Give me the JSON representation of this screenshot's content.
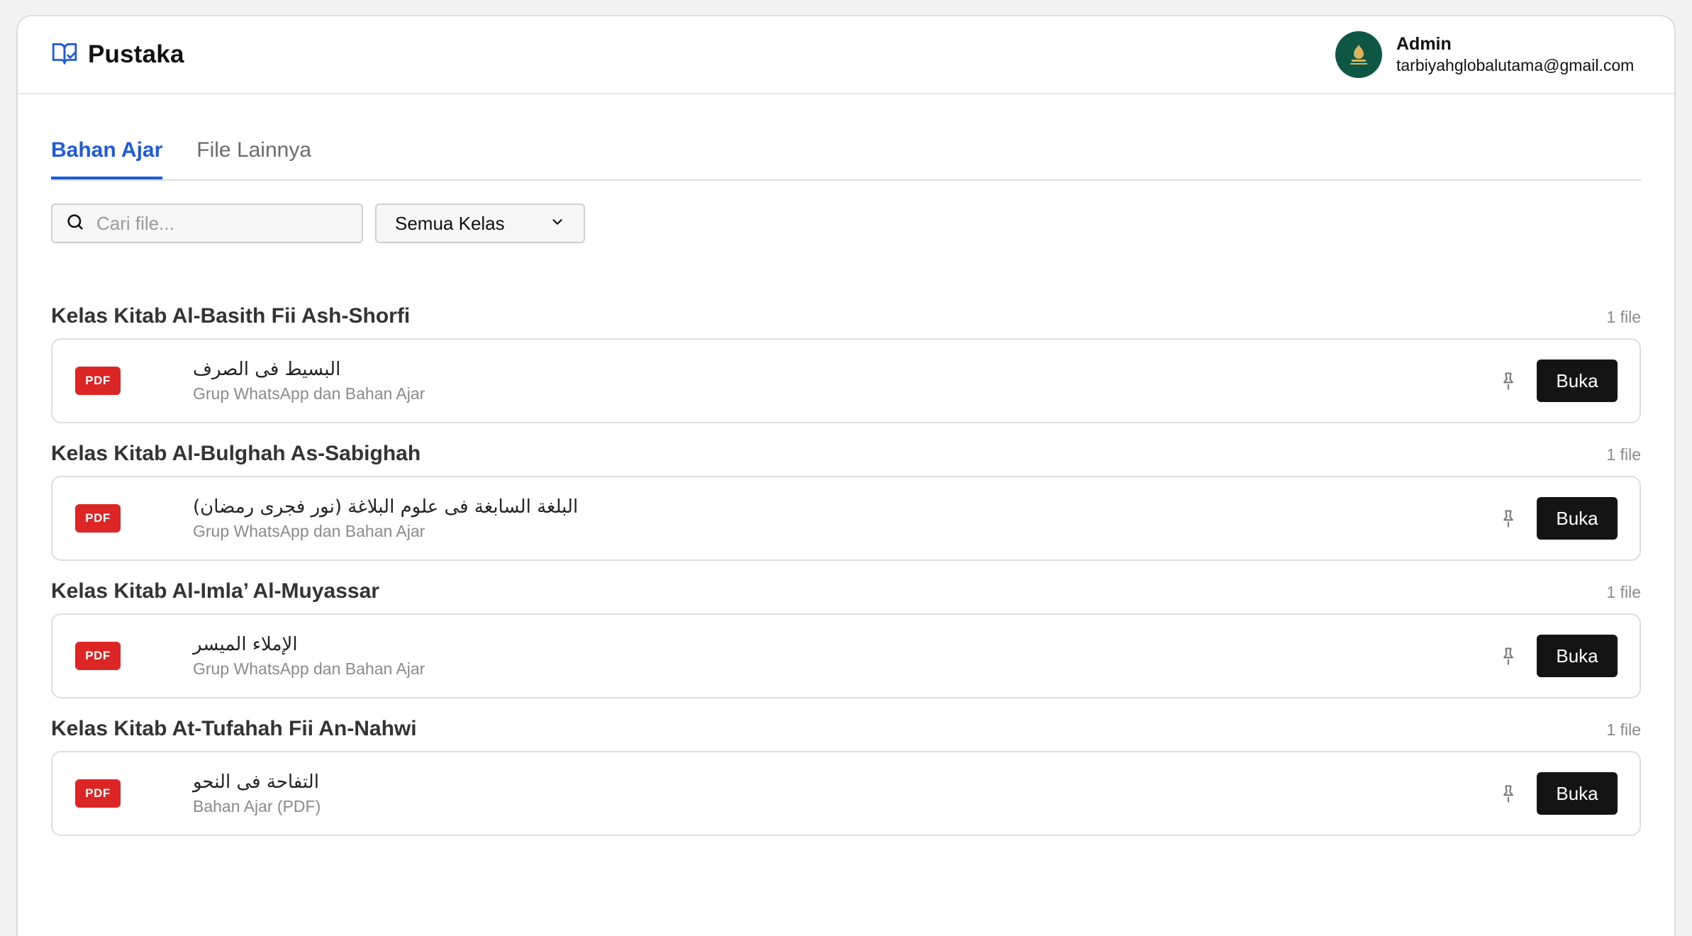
{
  "app": {
    "name": "Pustaka",
    "logo_icon": "book-open-check-icon"
  },
  "user": {
    "name": "Admin",
    "email": "tarbiyahglobalutama@gmail.com",
    "avatar_color": "#0d5744"
  },
  "tabs": [
    {
      "label": "Bahan Ajar",
      "active": true
    },
    {
      "label": "File Lainnya",
      "active": false
    }
  ],
  "search": {
    "placeholder": "Cari file...",
    "value": ""
  },
  "class_filter": {
    "selected": "Semua Kelas"
  },
  "colors": {
    "accent": "#1d5bd8",
    "pdf_badge": "#dc2626",
    "button": "#141414"
  },
  "groups": [
    {
      "title": "Kelas Kitab Al-Basith Fii Ash-Shorfi",
      "count": "1 file",
      "file": {
        "type": "PDF",
        "title": "البسيط فى الصرف",
        "subtitle": "Grup WhatsApp dan Bahan Ajar",
        "action": "Buka"
      }
    },
    {
      "title": "Kelas Kitab Al-Bulghah As-Sabighah",
      "count": "1 file",
      "file": {
        "type": "PDF",
        "title": "البلغة السابغة فى علوم البلاغة (نور فجرى رمضان)",
        "subtitle": "Grup WhatsApp dan Bahan Ajar",
        "action": "Buka"
      }
    },
    {
      "title": "Kelas Kitab Al-Imla’ Al-Muyassar",
      "count": "1 file",
      "file": {
        "type": "PDF",
        "title": "الإملاء الميسر",
        "subtitle": "Grup WhatsApp dan Bahan Ajar",
        "action": "Buka"
      }
    },
    {
      "title": "Kelas Kitab At-Tufahah Fii An-Nahwi",
      "count": "1 file",
      "file": {
        "type": "PDF",
        "title": "التفاحة فى النحو",
        "subtitle": "Bahan Ajar (PDF)",
        "action": "Buka"
      }
    }
  ]
}
